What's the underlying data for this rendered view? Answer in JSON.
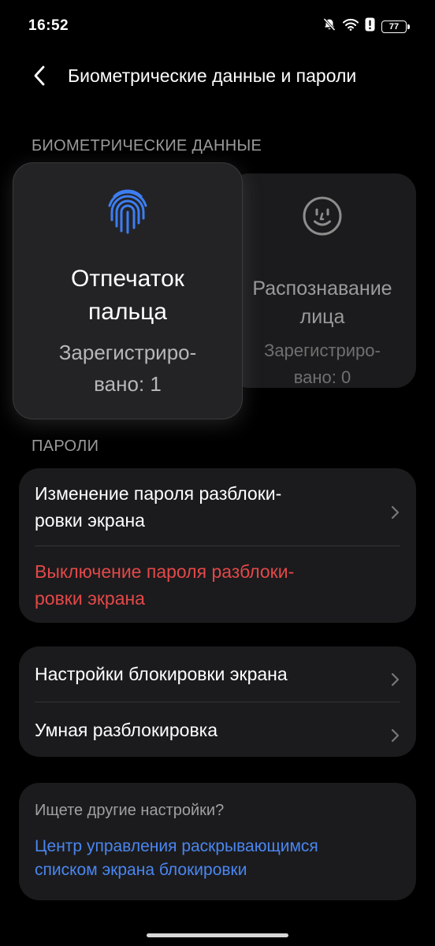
{
  "status_bar": {
    "time": "16:52",
    "battery": "77",
    "icons": [
      "bell-off-icon",
      "wifi-icon",
      "alert-icon",
      "battery-icon"
    ]
  },
  "header": {
    "title": "Биометрические данные и пароли",
    "back_icon": "chevron-left-icon"
  },
  "biometrics": {
    "section_label": "БИОМЕТРИЧЕСКИЕ ДАННЫЕ",
    "fingerprint": {
      "icon": "fingerprint-icon",
      "title_line1": "Отпечаток",
      "title_line2": "пальца",
      "status_line1": "Зарегистриро-",
      "status_line2": "вано: 1"
    },
    "face": {
      "icon": "face-icon",
      "title_line1": "Распознавание",
      "title_line2": "лица",
      "status_line1": "Зарегистриро-",
      "status_line2": "вано: 0"
    }
  },
  "passwords": {
    "section_label": "ПАРОЛИ",
    "change_line1": "Изменение пароля разблоки-",
    "change_line2": "ровки экрана",
    "disable_line1": "Выключение пароля разблоки-",
    "disable_line2": "ровки экрана"
  },
  "lock_settings": {
    "item1": "Настройки блокировки экрана",
    "item2": "Умная разблокировка"
  },
  "suggestions": {
    "hint": "Ищете другие настройки?",
    "link_line1": "Центр управления раскрывающимся",
    "link_line2": "списком экрана блокировки"
  },
  "colors": {
    "accent_blue": "#4a86f0",
    "danger_red": "#e34848",
    "card_bg": "#1b1b1d",
    "background": "#000000"
  }
}
